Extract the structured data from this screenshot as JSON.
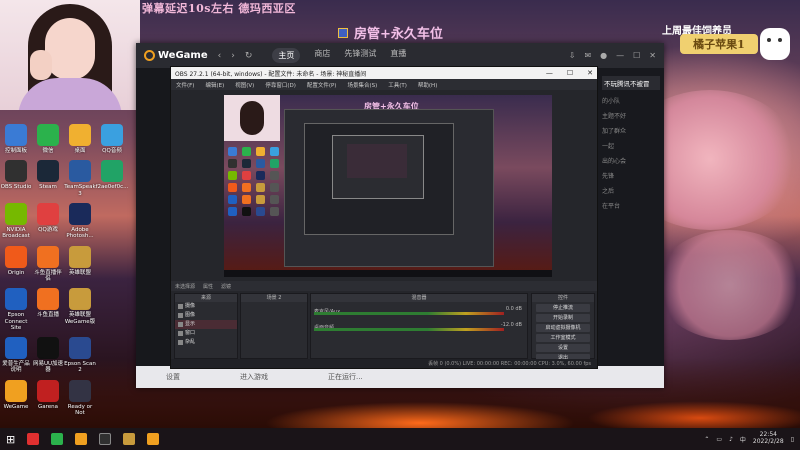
{
  "overlay": {
    "marquee": "弹幕延迟10s左右 德玛西亚区",
    "center_badge": "房管+永久车位",
    "right_badge_title": "上周最佳饲养员",
    "right_badge_name": "橘子苹果1"
  },
  "desktop_icons": [
    {
      "label": "控制面板",
      "color": "#3a7bd5"
    },
    {
      "label": "微信",
      "color": "#2bb24c"
    },
    {
      "label": "桌面",
      "color": "#f0b030"
    },
    {
      "label": "QQ音频",
      "color": "#3aa0e0"
    },
    {
      "label": "OBS Studio",
      "color": "#303030"
    },
    {
      "label": "Steam",
      "color": "#1b2838"
    },
    {
      "label": "TeamSpeak\n3",
      "color": "#2a5aa0"
    },
    {
      "label": "f2ae0ef0c...",
      "color": "#21a366"
    },
    {
      "label": "NVIDIA\nBroadcast",
      "color": "#76b900"
    },
    {
      "label": "QQ游戏",
      "color": "#e04040"
    },
    {
      "label": "Adobe\nPhotosh...",
      "color": "#1a2a5a"
    },
    {
      "label": "",
      "color": "transparent"
    },
    {
      "label": "Origin",
      "color": "#f05a1a"
    },
    {
      "label": "斗鱼直播伴侣",
      "color": "#f07020"
    },
    {
      "label": "英雄联盟",
      "color": "#c89b3c"
    },
    {
      "label": "",
      "color": "transparent"
    },
    {
      "label": "Epson\nConnect Site",
      "color": "#2060c0"
    },
    {
      "label": "斗鱼直播",
      "color": "#f07020"
    },
    {
      "label": "英雄联盟\nWeGame版",
      "color": "#c89b3c"
    },
    {
      "label": "",
      "color": "transparent"
    },
    {
      "label": "爱普生产品\n说明",
      "color": "#2060c0"
    },
    {
      "label": "网易UU加速\n器",
      "color": "#111111"
    },
    {
      "label": "Epson Scan\n2",
      "color": "#2a4a90"
    },
    {
      "label": "",
      "color": "transparent"
    },
    {
      "label": "WeGame",
      "color": "#f0a020"
    },
    {
      "label": "Garena",
      "color": "#c02020"
    },
    {
      "label": "Ready or\nNot",
      "color": "#333344"
    },
    {
      "label": "",
      "color": "transparent"
    }
  ],
  "wegame": {
    "logo": "WeGame",
    "nav": [
      "主页",
      "商店",
      "先锋测试",
      "直播"
    ],
    "friends": [
      "不玩腾讯不被冒",
      "的小队",
      "主题不好",
      "加了群众",
      "一起",
      "出的心会",
      "先锋",
      "之后",
      "在平台"
    ],
    "ad": "不玩腾讯不被冒",
    "bottom": [
      "设置",
      "进入游戏",
      "正在运行..."
    ]
  },
  "obs": {
    "title": "OBS 27.2.1 (64-bit, windows) - 配置文件: 未命名 - 场景: 神秘直播间",
    "menu": [
      "文件(F)",
      "编辑(E)",
      "视图(V)",
      "停靠窗口(D)",
      "配置文件(P)",
      "场景集合(S)",
      "工具(T)",
      "帮助(H)"
    ],
    "preview_badge": "房管+永久车位",
    "toolbar_label": "未选择源",
    "toolbar_props": "属性",
    "toolbar_filters": "滤镜",
    "panels": {
      "scenes_title": "来源",
      "sources_title": "场景 2",
      "mixer_title": "混音器",
      "controls_title": "控件"
    },
    "scenes": [
      "摄像",
      "图像",
      "显示",
      "窗口",
      "杂乱"
    ],
    "mixer": [
      {
        "name": "麦克风/Aux",
        "db": "0.0 dB"
      },
      {
        "name": "桌面音频",
        "db": "-12.0 dB"
      }
    ],
    "controls": [
      "停止推流",
      "开始录制",
      "启动虚拟摄像机",
      "工作室模式",
      "设置",
      "退出"
    ],
    "status": "丢帧 0 (0.0%)   LIVE: 00:00:00   REC: 00:00:00   CPU: 3.0%, 60.00 fps"
  },
  "taskbar": {
    "time": "22:54",
    "date": "2022/2/28"
  }
}
